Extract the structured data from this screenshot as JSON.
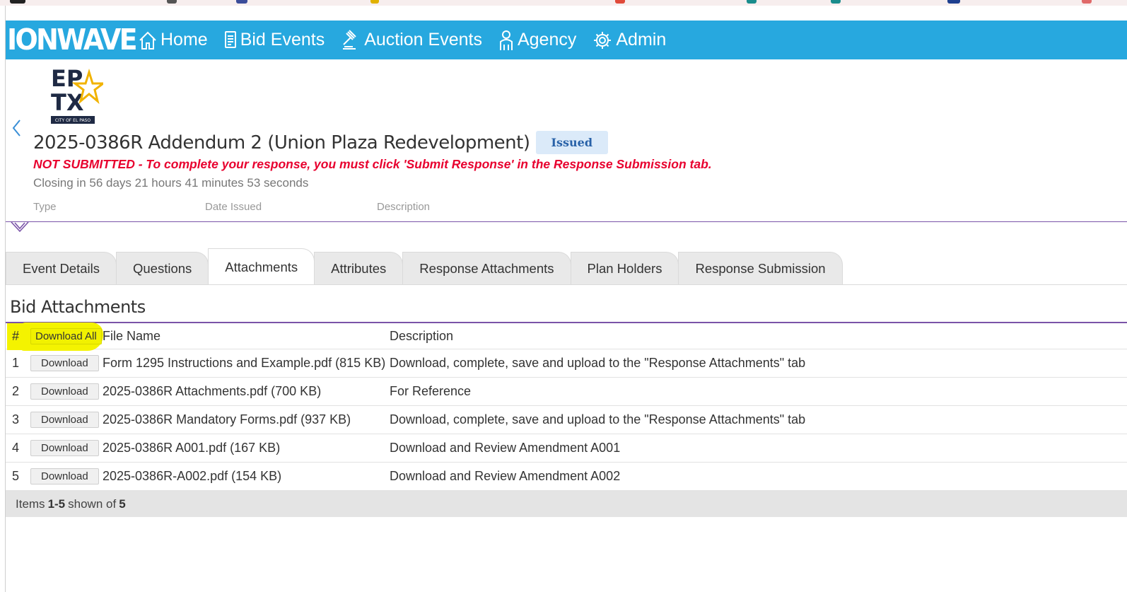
{
  "nav": {
    "logo": "IONWAVE",
    "items": [
      {
        "label": "Home",
        "icon": "home-icon"
      },
      {
        "label": "Bid Events",
        "icon": "document-icon"
      },
      {
        "label": "Auction Events",
        "icon": "gavel-icon"
      },
      {
        "label": "Agency",
        "icon": "user-icon"
      },
      {
        "label": "Admin",
        "icon": "gear-icon"
      }
    ]
  },
  "brand": {
    "line1": "EP",
    "line2": "TX",
    "tagline": "CITY OF EL PASO"
  },
  "event": {
    "title": "2025-0386R Addendum 2 (Union Plaza Redevelopment)",
    "status": "Issued",
    "warning": "NOT SUBMITTED - To complete your response, you must click 'Submit Response' in the Response Submission tab.",
    "closing": "Closing in 56 days 21 hours 41 minutes 53 seconds",
    "meta_labels": {
      "type": "Type",
      "date_issued": "Date Issued",
      "description": "Description"
    }
  },
  "tabs": [
    "Event Details",
    "Questions",
    "Attachments",
    "Attributes",
    "Response Attachments",
    "Plan Holders",
    "Response Submission"
  ],
  "active_tab": "Attachments",
  "attachments": {
    "section_title": "Bid Attachments",
    "headers": {
      "num": "#",
      "download_all": "Download All",
      "file_name": "File Name",
      "description": "Description"
    },
    "download_label": "Download",
    "rows": [
      {
        "num": "1",
        "file": "Form 1295 Instructions and Example.pdf (815 KB)",
        "description": "Download, complete, save and upload to the \"Response Attachments\" tab"
      },
      {
        "num": "2",
        "file": "2025-0386R Attachments.pdf (700 KB)",
        "description": "For Reference"
      },
      {
        "num": "3",
        "file": "2025-0386R Mandatory Forms.pdf (937 KB)",
        "description": "Download, complete, save and upload to the \"Response Attachments\" tab"
      },
      {
        "num": "4",
        "file": "2025-0386R A001.pdf (167 KB)",
        "description": "Download and Review Amendment A001"
      },
      {
        "num": "5",
        "file": "2025-0386R-A002.pdf (154 KB)",
        "description": "Download and Review Amendment A002"
      }
    ],
    "footer": {
      "prefix": "Items",
      "range": "1-5",
      "middle": "shown of",
      "total": "5"
    }
  },
  "colors": {
    "navbar": "#27a8df",
    "warning": "#e8002e",
    "accent_line": "#7a53a8",
    "highlight": "#f4f300",
    "badge_bg": "#dbeaf9"
  }
}
